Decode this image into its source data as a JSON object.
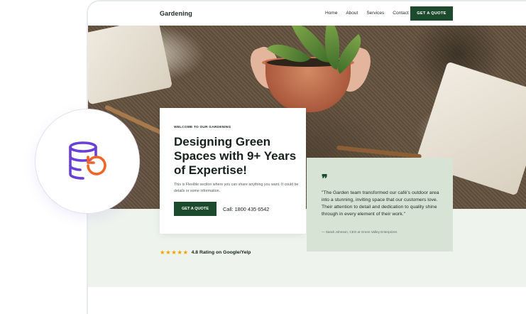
{
  "nav": {
    "brand": "Gardening",
    "links": [
      "Home",
      "About",
      "Services",
      "Contact"
    ],
    "cta": "GET A QUOTE"
  },
  "hero": {
    "eyebrow": "WELCOME TO OUR GARDENING",
    "headline": "Designing Green Spaces with 9+ Years of Expertise!",
    "description": "This is Flexible section where you can share anything you want. It could be details or some information.",
    "cta": "GET A QUOTE",
    "phone": "Call: 1800 435 6542"
  },
  "testimonial": {
    "quote_mark": "❞",
    "text": "\"The Garden team transformed our café’s outdoor area into a stunning, inviting space that our customers love. Their attention to detail and dedication to quality shine through in every element of their work.\"",
    "author": "— Sarah Johnson, CEO at Green Valley Enterprizes"
  },
  "rating": {
    "stars": "★★★★★",
    "text": "4.8 Rating on Google/Yelp"
  },
  "badge": {
    "icon": "database-restore-icon",
    "colors": {
      "purple": "#6a3fd8",
      "orange": "#f06426"
    }
  },
  "colors": {
    "accent": "#1c4a2d",
    "band": "#eef3ee",
    "quote_bg": "#d7e3d5",
    "star": "#f4a400"
  }
}
